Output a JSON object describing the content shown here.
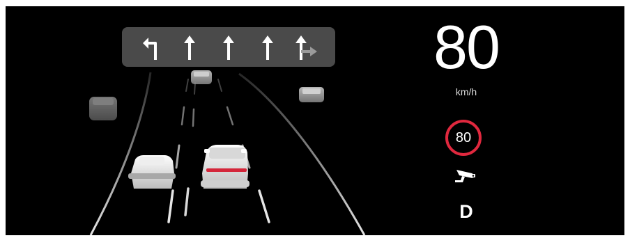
{
  "lane_guidance": {
    "lanes": [
      {
        "direction": "left-turn",
        "icon": "turn-left-arrow-icon"
      },
      {
        "direction": "straight",
        "icon": "straight-arrow-icon"
      },
      {
        "direction": "straight",
        "icon": "straight-arrow-icon"
      },
      {
        "direction": "straight",
        "icon": "straight-arrow-icon"
      },
      {
        "direction": "straight-or-right",
        "icon": "straight-right-arrow-icon"
      }
    ]
  },
  "speed": {
    "value": "80",
    "unit": "km/h"
  },
  "speed_limit": {
    "value": "80",
    "ring_color": "#e0283e"
  },
  "speed_camera": {
    "icon": "speed-camera-icon"
  },
  "gear": {
    "value": "D"
  },
  "colors": {
    "background": "#000000",
    "panel": "#4a4a4a",
    "text": "#ffffff",
    "tail_light": "#d4263a"
  }
}
